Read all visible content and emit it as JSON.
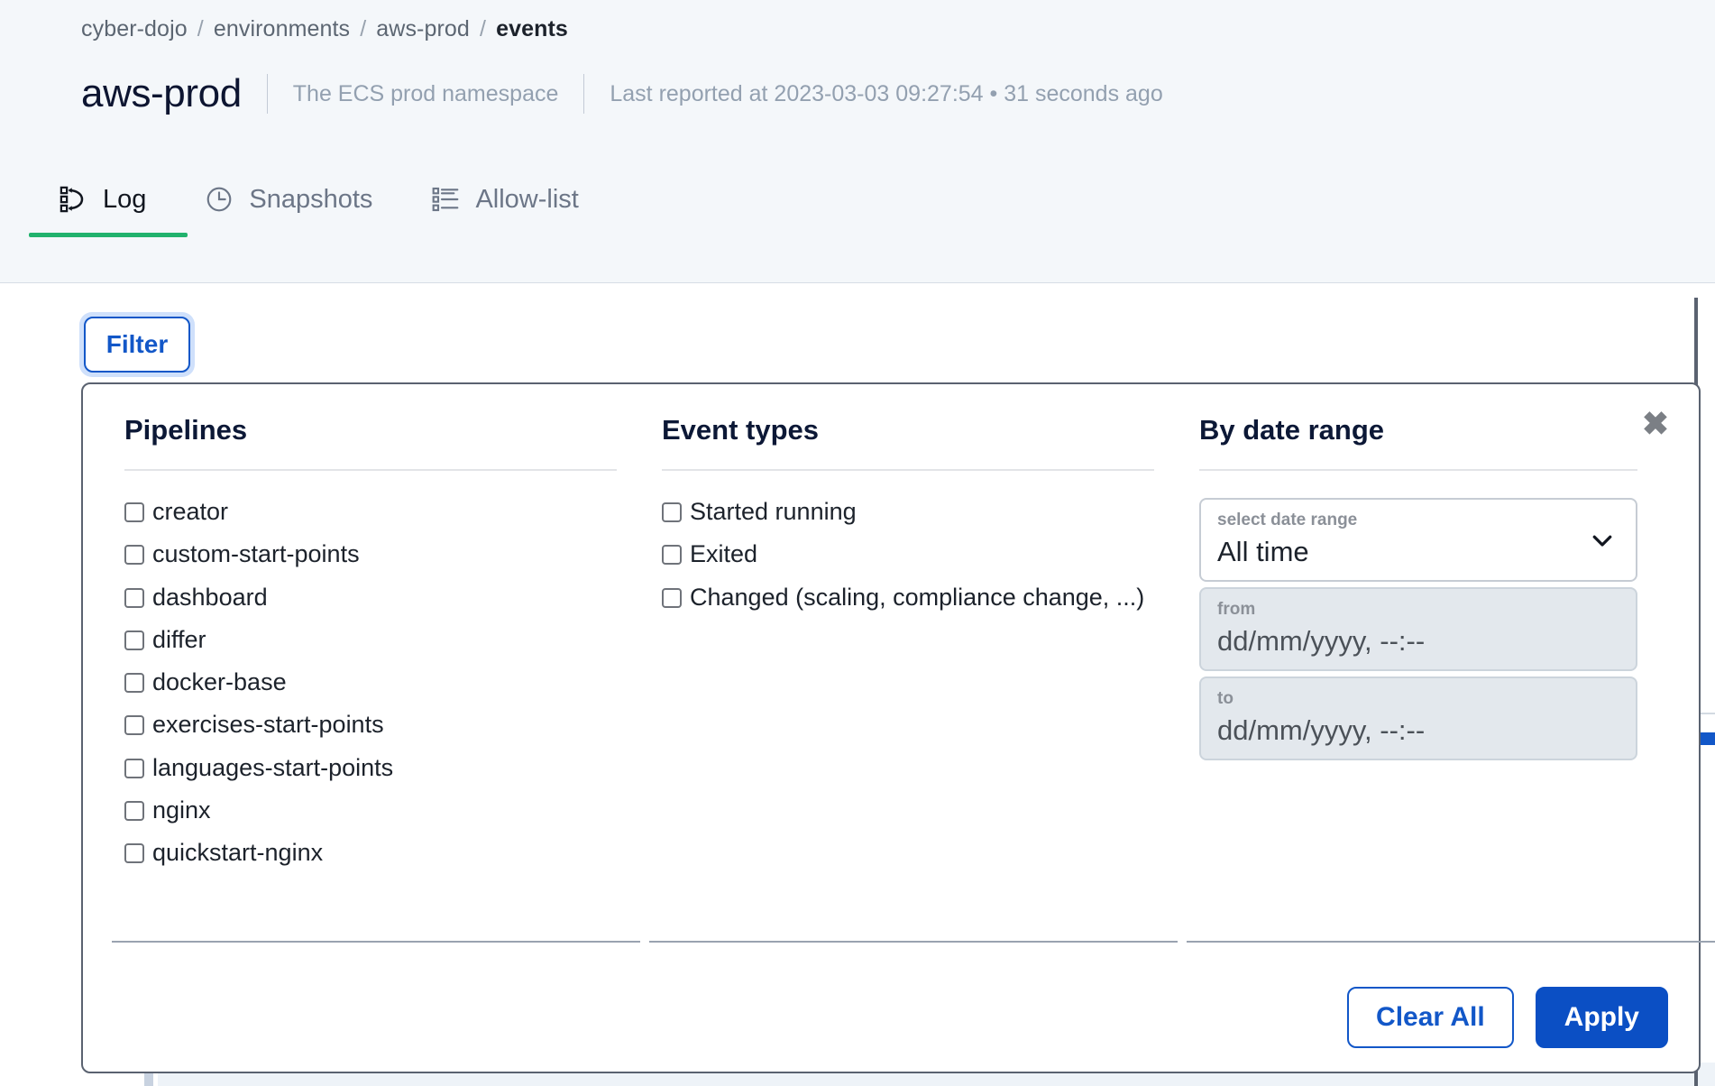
{
  "breadcrumb": {
    "items": [
      "cyber-dojo",
      "environments",
      "aws-prod"
    ],
    "item0": "cyber-dojo",
    "item1": "environments",
    "item2": "aws-prod",
    "current": "events",
    "separator": "/"
  },
  "header": {
    "title": "aws-prod",
    "description": "The ECS prod namespace",
    "last_reported": "Last reported at 2023-03-03 09:27:54 • 31 seconds ago"
  },
  "tabs": [
    {
      "label": "Log",
      "icon": "event-log-icon",
      "active": true
    },
    {
      "label": "Snapshots",
      "icon": "clock-icon",
      "active": false
    },
    {
      "label": "Allow-list",
      "icon": "list-icon",
      "active": false
    }
  ],
  "toolbar": {
    "filter_label": "Filter"
  },
  "filter_panel": {
    "close_label": "✖",
    "pipelines": {
      "title": "Pipelines",
      "items": [
        {
          "label": "creator",
          "checked": false
        },
        {
          "label": "custom-start-points",
          "checked": false
        },
        {
          "label": "dashboard",
          "checked": false
        },
        {
          "label": "differ",
          "checked": false
        },
        {
          "label": "docker-base",
          "checked": false
        },
        {
          "label": "exercises-start-points",
          "checked": false
        },
        {
          "label": "languages-start-points",
          "checked": false
        },
        {
          "label": "nginx",
          "checked": false
        },
        {
          "label": "quickstart-nginx",
          "checked": false
        }
      ]
    },
    "event_types": {
      "title": "Event types",
      "items": [
        {
          "label": "Started running",
          "checked": false
        },
        {
          "label": "Exited",
          "checked": false
        },
        {
          "label": "Changed (scaling, compliance change, ...)",
          "checked": false
        }
      ]
    },
    "date_range": {
      "title": "By date range",
      "select": {
        "caption": "select date range",
        "value": "All time",
        "options": [
          "All time"
        ]
      },
      "from": {
        "caption": "from",
        "placeholder": "dd/mm/yyyy, --:--",
        "value": "dd/mm/yyyy, --:--"
      },
      "to": {
        "caption": "to",
        "placeholder": "dd/mm/yyyy, --:--",
        "value": "dd/mm/yyyy, --:--"
      }
    },
    "footer": {
      "clear_label": "Clear All",
      "apply_label": "Apply"
    }
  },
  "colors": {
    "accent_blue": "#1257c8",
    "apply_blue": "#0b4fc4",
    "active_tab_green": "#21b26d",
    "heading_navy": "#0c1836",
    "header_bg": "#f4f7fa"
  }
}
